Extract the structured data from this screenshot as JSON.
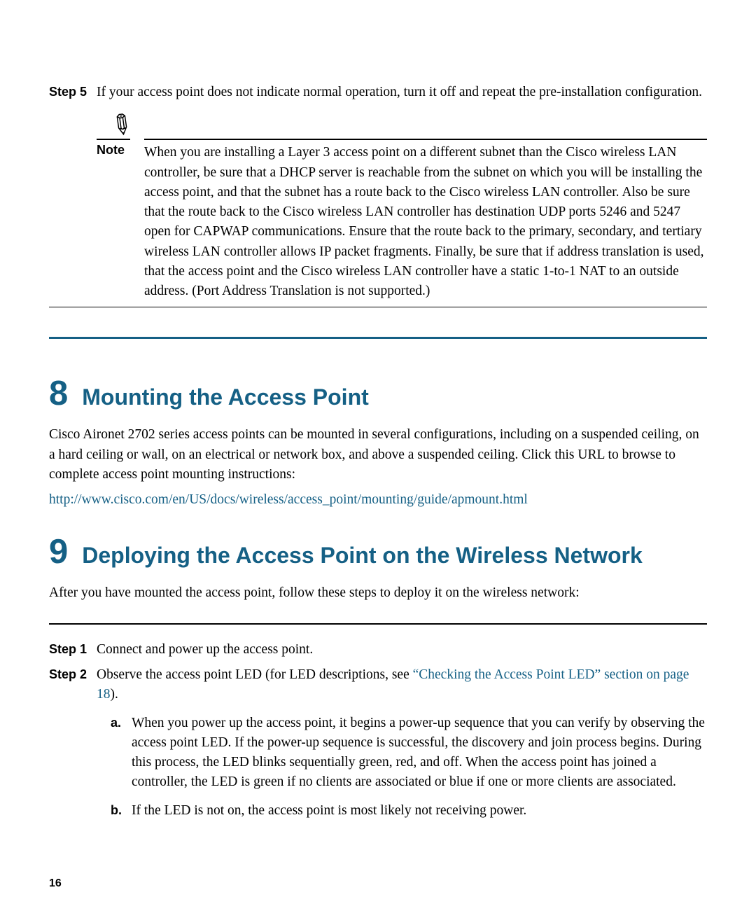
{
  "step5": {
    "label": "Step 5",
    "body": "If your access point does not indicate normal operation, turn it off and repeat the pre-installation configuration."
  },
  "note": {
    "label": "Note",
    "text": "When you are installing a Layer 3 access point on a different subnet than the Cisco wireless LAN controller, be sure that a DHCP server is reachable from the subnet on which you will be installing the access point, and that the subnet has a route back to the Cisco wireless LAN controller. Also be sure that the route back to the Cisco wireless LAN controller has destination UDP ports 5246 and 5247 open for CAPWAP communications. Ensure that the route back to the primary, secondary, and tertiary wireless LAN controller allows IP packet fragments. Finally, be sure that if address translation is used, that the access point and the Cisco wireless LAN controller have a static 1-to-1 NAT to an outside address. (Port Address Translation is not supported.)"
  },
  "section8": {
    "num": "8",
    "title": "Mounting the Access Point",
    "para": "Cisco Aironet 2702 series access points can be mounted in several configurations, including on a suspended ceiling, on a hard ceiling or wall, on an electrical or network box, and above a suspended ceiling. Click this URL to browse to complete access point mounting instructions:",
    "url": "http://www.cisco.com/en/US/docs/wireless/access_point/mounting/guide/apmount.html"
  },
  "section9": {
    "num": "9",
    "title": "Deploying the Access Point on the Wireless Network",
    "para": "After you have mounted the access point, follow these steps to deploy it on the wireless network:",
    "step1": {
      "label": "Step 1",
      "body": "Connect and power up the access point."
    },
    "step2": {
      "label": "Step 2",
      "bodyPrefix": "Observe the access point LED (for LED descriptions, see ",
      "linkText": "“Checking the Access Point LED” section on page 18",
      "bodySuffix": ").",
      "a": {
        "label": "a.",
        "text": "When you power up the access point, it begins a power-up sequence that you can verify by observing the access point LED. If the power-up sequence is successful, the discovery and join process begins. During this process, the LED blinks sequentially green, red, and off. When the access point has joined a controller, the LED is green if no clients are associated or blue if one or more clients are associated."
      },
      "b": {
        "label": "b.",
        "text": "If the LED is not on, the access point is most likely not receiving power."
      }
    }
  },
  "pageNum": "16"
}
